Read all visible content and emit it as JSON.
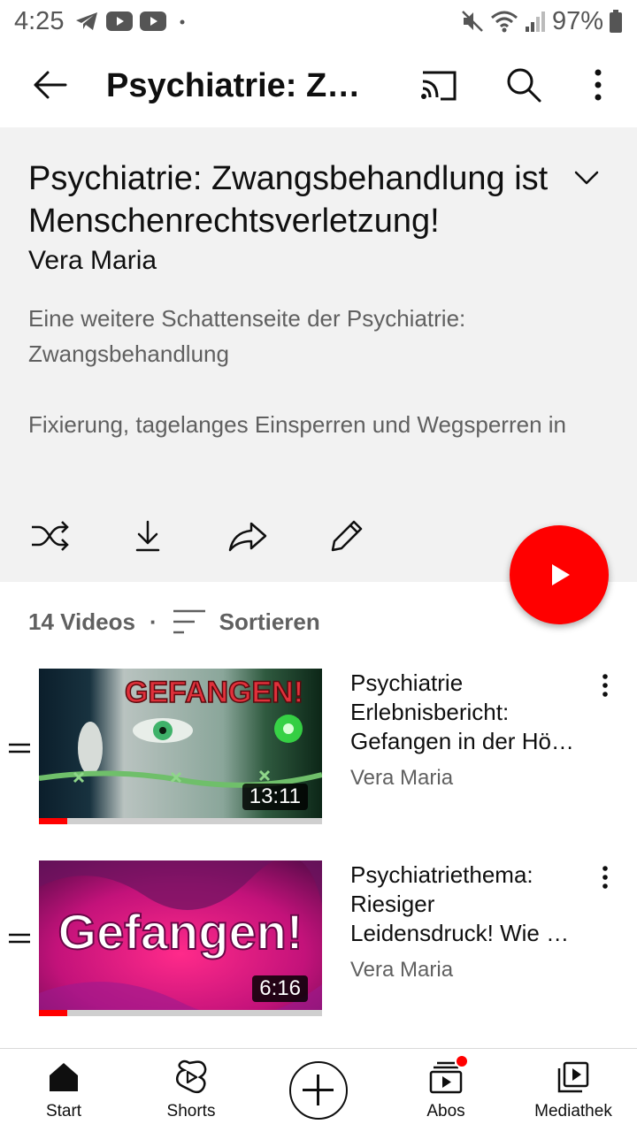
{
  "status_bar": {
    "time": "4:25",
    "battery": "97%",
    "icons_left": [
      "telegram-icon",
      "youtube-icon",
      "youtube-icon",
      "dot-icon"
    ],
    "icons_right": [
      "mute-icon",
      "wifi-icon",
      "signal-icon",
      "battery-icon"
    ]
  },
  "app_bar": {
    "title": "Psychiatrie: Zwangsbehandlung ist Menschenrechtsverletzung!",
    "icons": [
      "back-arrow-icon",
      "cast-icon",
      "search-icon",
      "more-vert-icon"
    ]
  },
  "playlist": {
    "title": "Psychiatrie: Zwangsbehandlung ist Menschenrechtsverletzung!",
    "owner": "Vera Maria",
    "description_lines": [
      "Eine weitere Schattenseite der Psychiatrie: Zwangsbehandlung",
      "Fixierung, tagelanges Einsperren und Wegsperren in"
    ],
    "actions": [
      "shuffle-icon",
      "download-icon",
      "share-icon",
      "edit-icon"
    ],
    "play_icon": "play-icon"
  },
  "list_meta": {
    "count": "14 Videos",
    "separator": "·",
    "sort_label": "Sortieren"
  },
  "videos": [
    {
      "title": "Psychiatrie Erlebnisbericht: Gefangen in der Hö…",
      "channel": "Vera Maria",
      "duration": "13:11",
      "thumb_text": "GEFANGEN!",
      "progress": 0.1,
      "accent": "#e0313b"
    },
    {
      "title": "Psychiatriethema: Riesiger Leidensdruck! Wie …",
      "channel": "Vera Maria",
      "duration": "6:16",
      "thumb_text": "Gefangen!",
      "progress": 0.1,
      "accent": "#e3167a"
    }
  ],
  "bottom_nav": {
    "items": [
      {
        "label": "Start",
        "icon": "home-icon"
      },
      {
        "label": "Shorts",
        "icon": "shorts-icon"
      },
      {
        "label": "",
        "icon": "create-icon"
      },
      {
        "label": "Abos",
        "icon": "subscriptions-icon"
      },
      {
        "label": "Mediathek",
        "icon": "library-icon"
      }
    ]
  },
  "colors": {
    "brand_red": "#ff0000",
    "panel_bg": "#f2f2f2",
    "secondary_text": "#606060"
  }
}
